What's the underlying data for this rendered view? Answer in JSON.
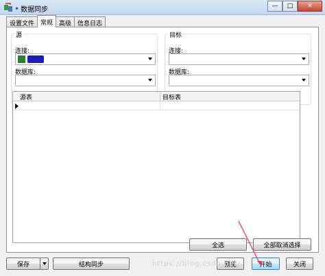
{
  "window": {
    "title": "* 数据同步",
    "minimize": "—",
    "maximize": "□",
    "close": "✕"
  },
  "tabs": [
    "设置文件",
    "常规",
    "高级",
    "信息日志"
  ],
  "source": {
    "title": "源",
    "connection_label": "连接:",
    "database_label": "数据库:"
  },
  "target": {
    "title": "目标",
    "connection_label": "连接:",
    "database_label": "数据库:"
  },
  "table": {
    "headers": [
      "源表",
      "目标表"
    ]
  },
  "buttons": {
    "select_all": "全选",
    "deselect_all": "全部取消选择",
    "save": "保存",
    "structure_sync": "结构同步",
    "preview": "预览",
    "start": "开始",
    "close": "关闭"
  },
  "watermark": "https://blog.csdn.net/",
  "icons": {
    "app": "sync-app-icon",
    "connection": "db-connection-icon"
  },
  "colors": {
    "annotation_arrow": "#e8404d",
    "titlebar": "#c3d7ee",
    "focused_button": "#bee6fd"
  }
}
